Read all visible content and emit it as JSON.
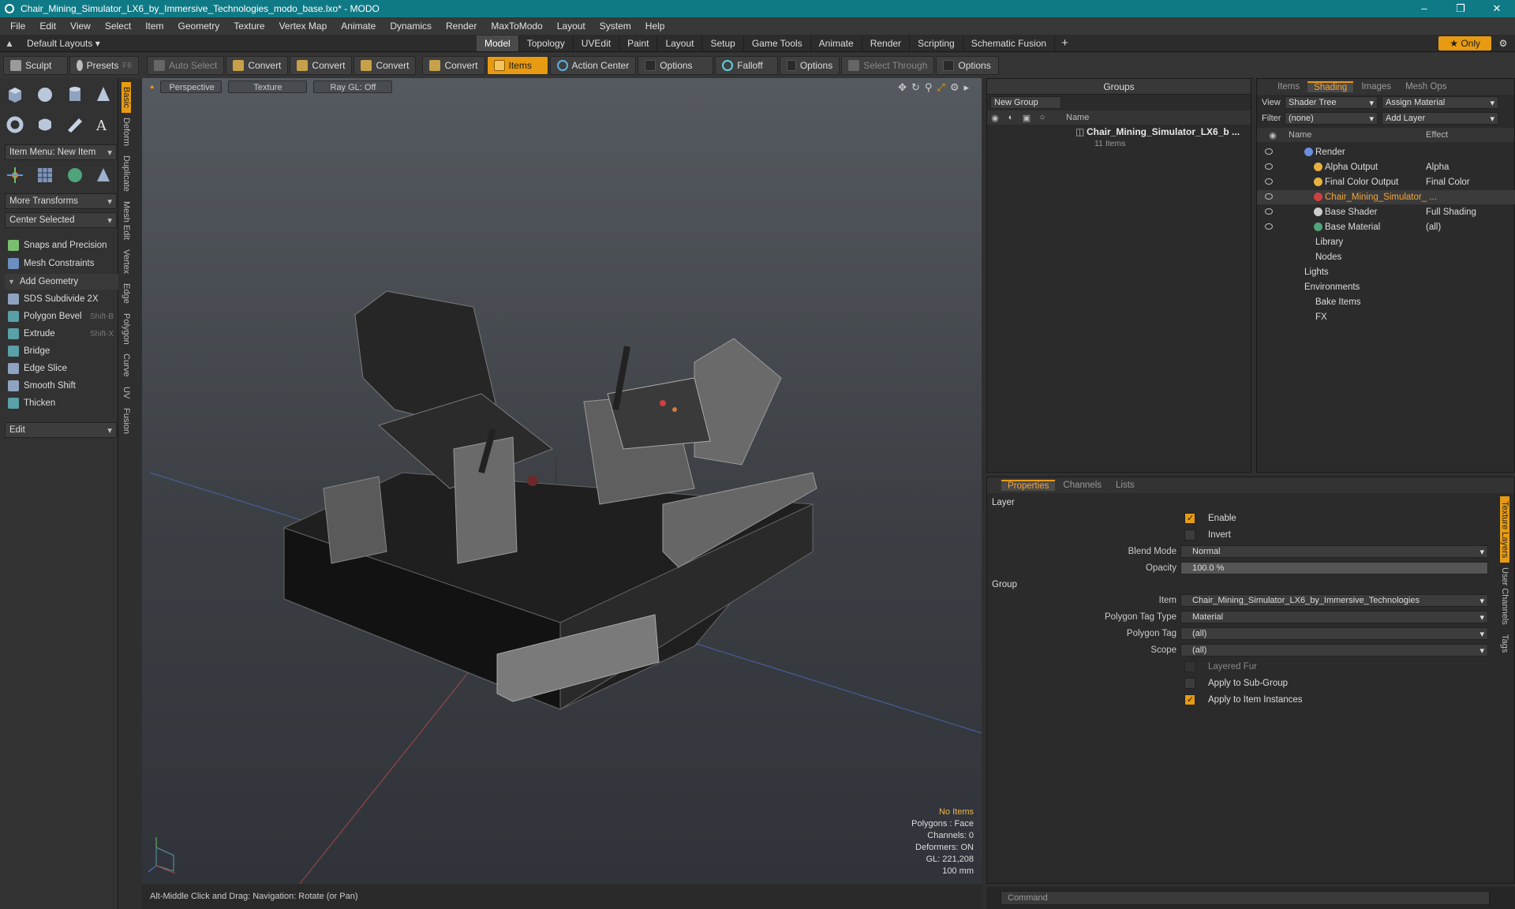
{
  "window": {
    "title": "Chair_Mining_Simulator_LX6_by_Immersive_Technologies_modo_base.lxo* - MODO",
    "controls": [
      "–",
      "❒",
      "✕"
    ]
  },
  "menu": [
    "File",
    "Edit",
    "View",
    "Select",
    "Item",
    "Geometry",
    "Texture",
    "Vertex Map",
    "Animate",
    "Dynamics",
    "Render",
    "MaxToModo",
    "Layout",
    "System",
    "Help"
  ],
  "modebar": {
    "layouts": "Default Layouts ▾",
    "tabs": [
      "Model",
      "Topology",
      "UVEdit",
      "Paint",
      "Layout",
      "Setup",
      "Game Tools",
      "Animate",
      "Render",
      "Scripting",
      "Schematic Fusion"
    ],
    "active": "Model",
    "only": "★ Only"
  },
  "toolbar": {
    "sculpt": "Sculpt",
    "presets": "Presets",
    "presets_key": "F6",
    "auto_select": "Auto Select",
    "convert": "Convert",
    "items": "Items",
    "action_center": "Action Center",
    "options": "Options",
    "falloff": "Falloff",
    "select_through": "Select Through"
  },
  "left": {
    "item_menu": "Item Menu: New Item",
    "more_transforms": "More Transforms",
    "center_selected": "Center Selected",
    "snaps": "Snaps and Precision",
    "mesh_constraints": "Mesh Constraints",
    "add_geometry": "Add Geometry",
    "tools": [
      {
        "label": "SDS Subdivide 2X",
        "key": ""
      },
      {
        "label": "Polygon Bevel",
        "key": "Shift-B"
      },
      {
        "label": "Extrude",
        "key": "Shift-X"
      },
      {
        "label": "Bridge",
        "key": ""
      },
      {
        "label": "Edge Slice",
        "key": ""
      },
      {
        "label": "Smooth Shift",
        "key": ""
      },
      {
        "label": "Thicken",
        "key": ""
      }
    ],
    "edit": "Edit"
  },
  "vtabs": [
    "Basic",
    "Deform",
    "Duplicate",
    "Mesh Edit",
    "Vertex",
    "Edge",
    "Polygon",
    "Curve",
    "UV",
    "Fusion"
  ],
  "viewport": {
    "perspective": "Perspective",
    "texture": "Texture",
    "raygl": "Ray GL: Off",
    "info": {
      "items": "No Items",
      "polygons": "Polygons : Face",
      "channels": "Channels: 0",
      "deformers": "Deformers: ON",
      "gl": "GL: 221,208",
      "scale": "100 mm"
    }
  },
  "status": "Alt-Middle Click and Drag:   Navigation: Rotate (or Pan)",
  "groups": {
    "title": "Groups",
    "new_group": "New Group",
    "col_name": "Name",
    "item": "Chair_Mining_Simulator_LX6_b ...",
    "count": "11 Items"
  },
  "shading": {
    "tabs": [
      "Items",
      "Shading",
      "Images",
      "Mesh Ops"
    ],
    "active": "Shading",
    "view_label": "View",
    "view": "Shader Tree",
    "assign": "Assign Material",
    "filter_label": "Filter",
    "filter": "(none)",
    "add_layer": "Add Layer",
    "col_name": "Name",
    "col_effect": "Effect",
    "tree": [
      {
        "name": "Render",
        "effect": "",
        "eye": true
      },
      {
        "name": "Alpha Output",
        "effect": "Alpha",
        "eye": true
      },
      {
        "name": "Final Color Output",
        "effect": "Final Color",
        "eye": true
      },
      {
        "name": "Chair_Mining_Simulator_ ...",
        "effect": "",
        "eye": true
      },
      {
        "name": "Base Shader",
        "effect": "Full Shading",
        "eye": true
      },
      {
        "name": "Base Material",
        "effect": "(all)",
        "eye": true
      },
      {
        "name": "Library",
        "effect": "",
        "eye": false
      },
      {
        "name": "Nodes",
        "effect": "",
        "eye": false
      },
      {
        "name": "Lights",
        "effect": "",
        "eye": false
      },
      {
        "name": "Environments",
        "effect": "",
        "eye": false
      },
      {
        "name": "Bake Items",
        "effect": "",
        "eye": false
      },
      {
        "name": "FX",
        "effect": "",
        "eye": false
      }
    ]
  },
  "props": {
    "tabs": [
      "Properties",
      "Channels",
      "Lists"
    ],
    "active": "Properties",
    "layer": "Layer",
    "enable": "Enable",
    "invert": "Invert",
    "blend_mode_label": "Blend Mode",
    "blend_mode": "Normal",
    "opacity_label": "Opacity",
    "opacity": "100.0 %",
    "group": "Group",
    "item_label": "Item",
    "item": "Chair_Mining_Simulator_LX6_by_Immersive_Technologies",
    "ptt_label": "Polygon Tag Type",
    "ptt": "Material",
    "pt_label": "Polygon Tag",
    "pt": "(all)",
    "scope_label": "Scope",
    "scope": "(all)",
    "layered_fur": "Layered Fur",
    "sub_group": "Apply to Sub-Group",
    "instances": "Apply to Item Instances",
    "side_tabs": [
      "Texture Layers",
      "User Channels",
      "Tags"
    ]
  },
  "command": "Command",
  "colors": {
    "accent": "#e89b12",
    "title": "#0f7a86"
  }
}
